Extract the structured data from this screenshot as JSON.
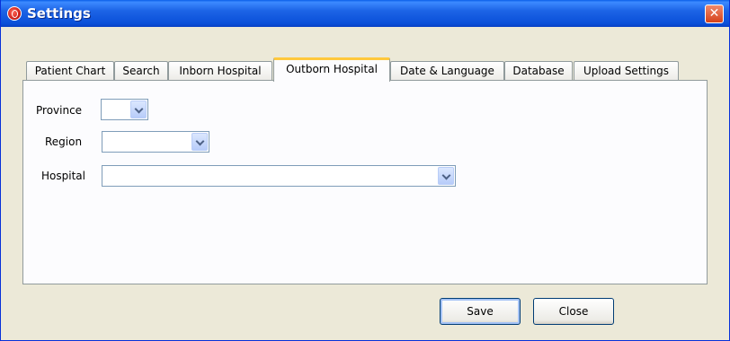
{
  "window": {
    "title": "Settings",
    "close_glyph": "✕"
  },
  "tabs": [
    {
      "label": "Patient Chart"
    },
    {
      "label": "Search"
    },
    {
      "label": "Inborn Hospital"
    },
    {
      "label": "Outborn Hospital"
    },
    {
      "label": "Date & Language"
    },
    {
      "label": "Database"
    },
    {
      "label": "Upload Settings"
    }
  ],
  "active_tab": "Outborn Hospital",
  "form": {
    "province_label": "Province",
    "province_value": "",
    "region_label": "Region",
    "region_value": "",
    "hospital_label": "Hospital",
    "hospital_value": ""
  },
  "buttons": {
    "save": "Save",
    "close": "Close"
  },
  "colors": {
    "titlebar": "#0a4fd8",
    "active_tab_highlight": "#ffc83c",
    "close_button": "#d5411a"
  }
}
